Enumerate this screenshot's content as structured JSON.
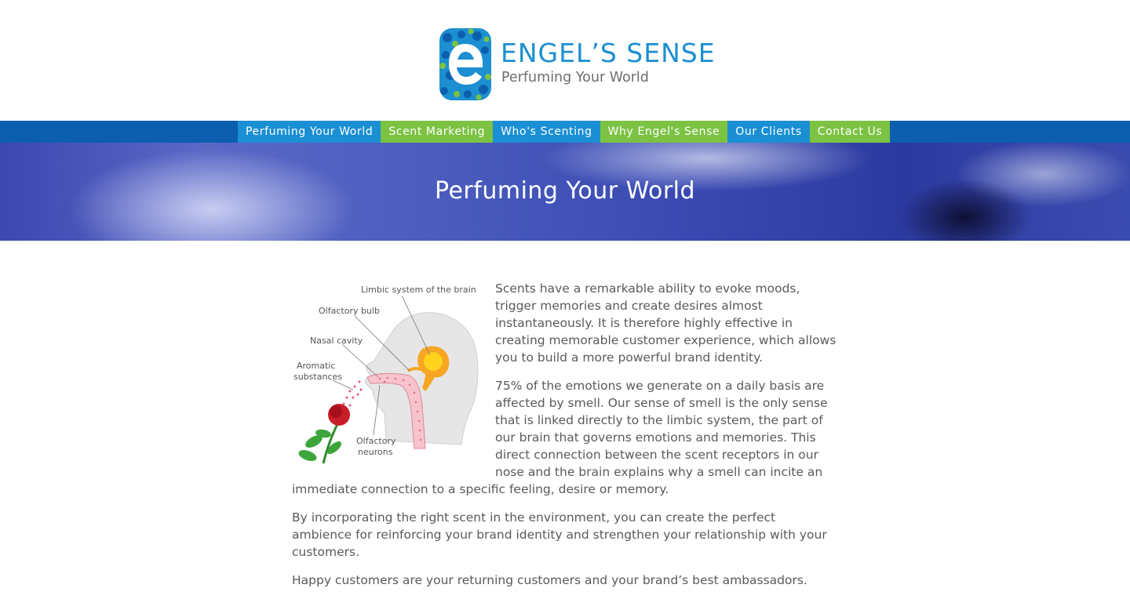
{
  "brand": {
    "name": "ENGEL’S SENSE",
    "tagline": "Perfuming Your World",
    "colors": {
      "primary_blue": "#1c8fd0",
      "green": "#7cc243",
      "nav_bar": "#0b5fae"
    }
  },
  "nav": {
    "items": [
      {
        "label": "Perfuming Your World",
        "color": "blue"
      },
      {
        "label": "Scent Marketing",
        "color": "green"
      },
      {
        "label": "Who's Scenting",
        "color": "blue"
      },
      {
        "label": "Why Engel's Sense",
        "color": "green"
      },
      {
        "label": "Our Clients",
        "color": "blue"
      },
      {
        "label": "Contact Us",
        "color": "green"
      }
    ]
  },
  "hero": {
    "title": "Perfuming Your World"
  },
  "figure": {
    "labels": {
      "limbic": "Limbic system of the brain",
      "bulb": "Olfactory bulb",
      "nasal": "Nasal cavity",
      "aromatic_1": "Aromatic",
      "aromatic_2": "substances",
      "neurons_1": "Olfactory",
      "neurons_2": "neurons"
    }
  },
  "content": {
    "paragraphs": [
      "Scents have a remarkable ability to evoke moods, trigger memories and create desires almost instantaneously. It is therefore highly effective in creating memorable customer experience, which allows you to build a more powerful brand identity.",
      "75% of the emotions we generate on a daily basis are affected by smell. Our sense of smell is the only sense that is linked directly to the limbic system, the part of our brain that governs emotions and memories. This direct connection between the scent receptors in our nose and the brain explains why a smell can incite an immediate connection to a specific feeling, desire or memory.",
      "By incorporating the right scent in the environment, you can create the perfect ambience for reinforcing your brand identity and strengthen your relationship with your customers.",
      "Happy customers are your returning customers and your brand’s best ambassadors."
    ]
  }
}
